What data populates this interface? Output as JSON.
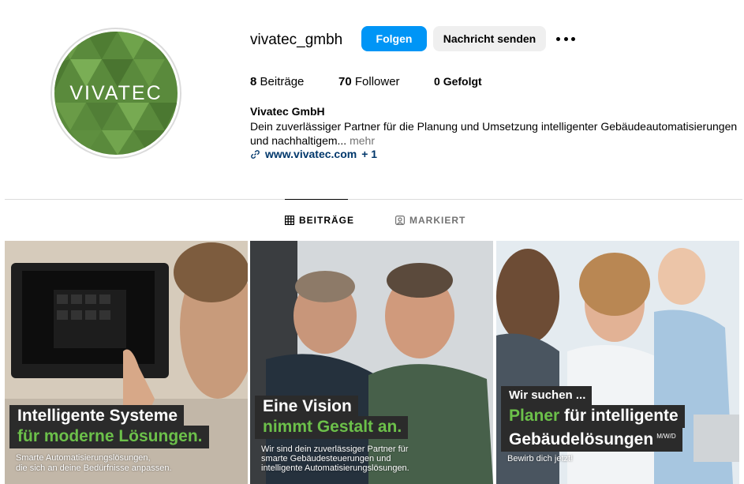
{
  "profile": {
    "username": "vivatec_gmbh",
    "avatar_text": "VIVATEC",
    "follow_label": "Folgen",
    "message_label": "Nachricht senden",
    "more_icon": "more-horizontal-icon",
    "stats": {
      "posts_count": "8",
      "posts_label": "Beiträge",
      "followers_count": "70",
      "followers_label": "Follower",
      "following_count": "0",
      "following_label": "Gefolgt"
    },
    "full_name": "Vivatec GmbH",
    "bio": "Dein zuverlässiger Partner für die Planung und Umsetzung intelligenter Gebäudeautomatisierungen und nachhaltigem...",
    "bio_more": "mehr",
    "link_text": "www.vivatec.com",
    "link_extra": "+ 1"
  },
  "tabs": {
    "posts": "BEITRÄGE",
    "tagged": "MARKIERT"
  },
  "posts": [
    {
      "line1": "Intelligente Systeme",
      "line2": "für moderne Lösungen.",
      "caption1": "Smarte Automatisierungslösungen,",
      "caption2": "die sich an deine Bedürfnisse anpassen."
    },
    {
      "line1": "Eine Vision",
      "line2": "nimmt Gestalt an.",
      "caption1": "Wir sind dein zuverlässiger Partner für",
      "caption2": "smarte Gebäudesteuerungen und",
      "caption3": "intelligente Automatisierungslösungen."
    },
    {
      "kicker": "Wir suchen ...",
      "line1_green": "Planer",
      "line1_rest": " für intelligente",
      "line2": "Gebäudelösungen",
      "line2_suffix": "M/W/D",
      "caption1": "Bewirb dich jetzt!"
    }
  ],
  "colors": {
    "accent_blue": "#0095f6",
    "brand_green": "#6cc04a",
    "link_blue": "#00376b"
  }
}
